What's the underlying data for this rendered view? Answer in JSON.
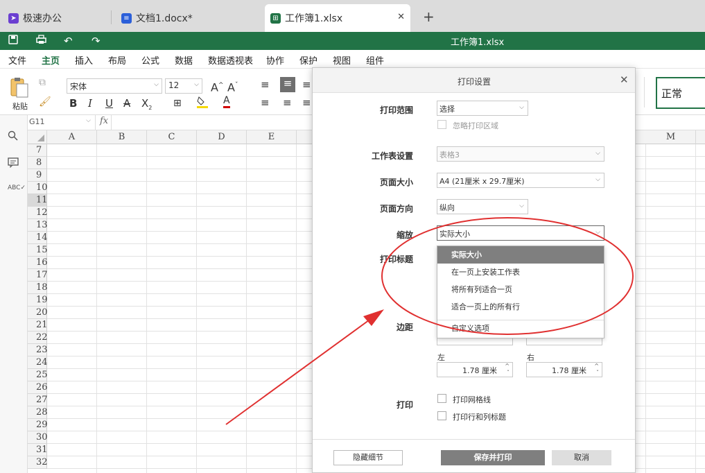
{
  "tabs": [
    {
      "label": "极速办公",
      "icon": "rocket-icon",
      "color": "#6b3fd1"
    },
    {
      "label": "文档1.docx*",
      "icon": "doc-icon",
      "color": "#2b5fd9"
    },
    {
      "label": "工作簿1.xlsx",
      "icon": "sheet-icon",
      "color": "#217346"
    }
  ],
  "new_tab_symbol": "+",
  "tab_close_symbol": "✕",
  "titlebar": {
    "title": "工作簿1.xlsx"
  },
  "menu": [
    "文件",
    "主页",
    "插入",
    "布局",
    "公式",
    "数据",
    "数据透视表",
    "协作",
    "保护",
    "视图",
    "组件"
  ],
  "ribbon": {
    "paste_label": "粘贴",
    "font_name": "宋体",
    "font_size": "12",
    "style_name": "正常",
    "bold": "B",
    "italic": "I",
    "underline": "U",
    "strike": "A",
    "subscript": "X",
    "font_grow": "A",
    "font_shrink": "A"
  },
  "formula_bar": {
    "cell_ref": "G11",
    "fx": "fx"
  },
  "grid": {
    "columns": [
      "A",
      "B",
      "C",
      "D",
      "E",
      "M"
    ],
    "rows": [
      "7",
      "8",
      "9",
      "10",
      "11",
      "12",
      "13",
      "14",
      "15",
      "16",
      "17",
      "18",
      "19",
      "20",
      "21",
      "22",
      "23",
      "24",
      "25",
      "26",
      "27",
      "28",
      "29",
      "30",
      "31",
      "32"
    ],
    "selected_row": "11"
  },
  "dialog": {
    "title": "打印设置",
    "print_range_label": "打印范围",
    "print_range_value": "选择",
    "ignore_area_label": "忽略打印区域",
    "sheet_label": "工作表设置",
    "sheet_value": "表格3",
    "page_size_label": "页面大小",
    "page_size_value": "A4 (21厘米 x 29.7厘米)",
    "orientation_label": "页面方向",
    "orientation_value": "纵向",
    "scale_label": "缩放",
    "scale_value": "实际大小",
    "print_titles_label": "打印标题",
    "margins_label": "边距",
    "left_label": "左",
    "left_value": "1.78 厘米",
    "right_label": "右",
    "right_value": "1.78 厘米",
    "print_label": "打印",
    "gridlines_label": "打印网格线",
    "headings_label": "打印行和列标题",
    "hide_details_label": "隐藏细节",
    "save_print_label": "保存并打印",
    "cancel_label": "取消",
    "scale_options": [
      "实际大小",
      "在一页上安装工作表",
      "将所有列适合一页",
      "适合一页上的所有行",
      "自定义选项"
    ]
  },
  "annotation_color": "#e03030"
}
